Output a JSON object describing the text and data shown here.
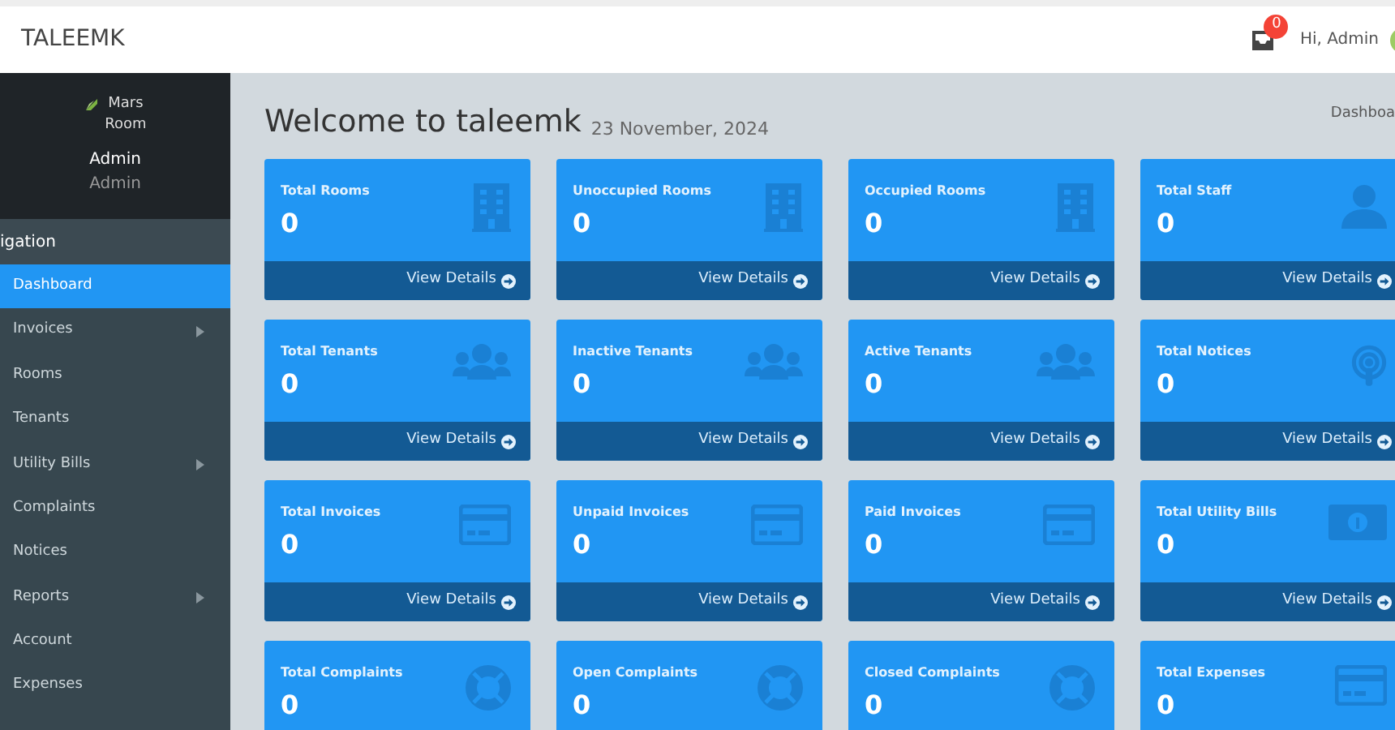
{
  "topbar": {
    "brand": "TALEEMK",
    "notification_count": "0",
    "greeting": "Hi, Admin"
  },
  "sidebar": {
    "logo_alt": "Mars Room",
    "user_name": "Admin",
    "user_role": "Admin",
    "nav_header": "igation",
    "items": [
      {
        "label": "Dashboard",
        "selected": true,
        "expandable": false
      },
      {
        "label": "Invoices",
        "selected": false,
        "expandable": true
      },
      {
        "label": "Rooms",
        "selected": false,
        "expandable": false
      },
      {
        "label": "Tenants",
        "selected": false,
        "expandable": false
      },
      {
        "label": "Utility Bills",
        "selected": false,
        "expandable": true
      },
      {
        "label": "Complaints",
        "selected": false,
        "expandable": false
      },
      {
        "label": "Notices",
        "selected": false,
        "expandable": false
      },
      {
        "label": "Reports",
        "selected": false,
        "expandable": true
      },
      {
        "label": "Account",
        "selected": false,
        "expandable": false
      },
      {
        "label": "Expenses",
        "selected": false,
        "expandable": false
      }
    ]
  },
  "page": {
    "title": "Welcome to taleemk",
    "date": "23 November, 2024",
    "breadcrumb": "Dashboa"
  },
  "cards": [
    {
      "title": "Total Rooms",
      "value": "0",
      "kind": "building",
      "link": "View Details"
    },
    {
      "title": "Unoccupied Rooms",
      "value": "0",
      "kind": "building",
      "link": "View Details"
    },
    {
      "title": "Occupied Rooms",
      "value": "0",
      "kind": "building",
      "link": "View Details"
    },
    {
      "title": "Total Staff",
      "value": "0",
      "kind": "user",
      "link": "View Details"
    },
    {
      "title": "Total Tenants",
      "value": "0",
      "kind": "users",
      "link": "View Details"
    },
    {
      "title": "Inactive Tenants",
      "value": "0",
      "kind": "users",
      "link": "View Details"
    },
    {
      "title": "Active Tenants",
      "value": "0",
      "kind": "users",
      "link": "View Details"
    },
    {
      "title": "Total Notices",
      "value": "0",
      "kind": "podcast",
      "link": "View Details"
    },
    {
      "title": "Total Invoices",
      "value": "0",
      "kind": "card",
      "link": "View Details"
    },
    {
      "title": "Unpaid Invoices",
      "value": "0",
      "kind": "card",
      "link": "View Details"
    },
    {
      "title": "Paid Invoices",
      "value": "0",
      "kind": "card",
      "link": "View Details"
    },
    {
      "title": "Total Utility Bills",
      "value": "0",
      "kind": "money",
      "link": "View Details"
    },
    {
      "title": "Total Complaints",
      "value": "0",
      "kind": "lifering"
    },
    {
      "title": "Open Complaints",
      "value": "0",
      "kind": "lifering"
    },
    {
      "title": "Closed Complaints",
      "value": "0",
      "kind": "lifering"
    },
    {
      "title": "Total Expenses",
      "value": "0",
      "kind": "card"
    }
  ]
}
